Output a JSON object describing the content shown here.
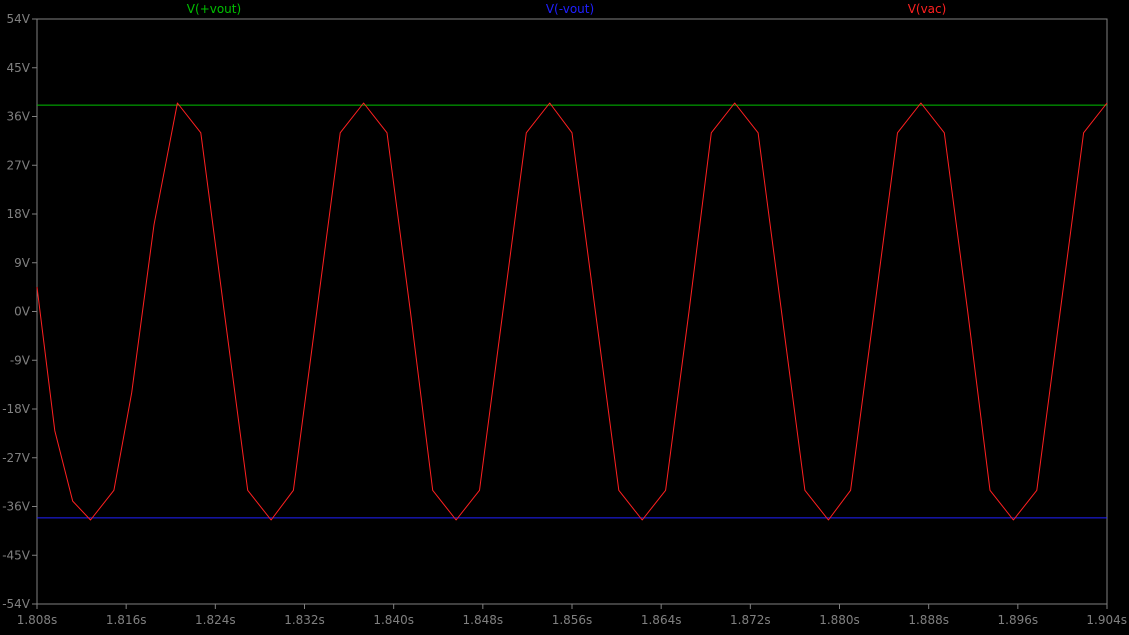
{
  "chart_data": {
    "type": "line",
    "title": "",
    "xlabel": "",
    "ylabel": "",
    "xlim": [
      1.808,
      1.904
    ],
    "ylim": [
      -54,
      54
    ],
    "x_ticks": [
      "1.808s",
      "1.816s",
      "1.824s",
      "1.832s",
      "1.840s",
      "1.848s",
      "1.856s",
      "1.864s",
      "1.872s",
      "1.880s",
      "1.888s",
      "1.896s",
      "1.904s"
    ],
    "y_ticks": [
      "54V",
      "45V",
      "36V",
      "27V",
      "18V",
      "9V",
      "0V",
      "-9V",
      "-18V",
      "-27V",
      "-36V",
      "-45V",
      "-54V"
    ],
    "legend_placement": "top",
    "grid": false,
    "background_color": "#000000",
    "axis_color": "#808080",
    "series": [
      {
        "name": "V(+vout)",
        "color": "#00c000",
        "x": [
          1.808,
          1.904
        ],
        "y": [
          38.1,
          38.1
        ]
      },
      {
        "name": "V(-vout)",
        "color": "#2020ff",
        "x": [
          1.808,
          1.904
        ],
        "y": [
          -38.1,
          -38.1
        ]
      },
      {
        "name": "V(vac)",
        "color": "#ff2020",
        "x": [
          1.808,
          1.8096,
          1.8112,
          1.8128,
          1.8149,
          1.8165,
          1.8185,
          1.8206,
          1.8227,
          1.8248,
          1.8269,
          1.829,
          1.831,
          1.8331,
          1.8352,
          1.8373,
          1.8394,
          1.8415,
          1.8435,
          1.8456,
          1.8477,
          1.8498,
          1.8519,
          1.854,
          1.856,
          1.8581,
          1.8602,
          1.8623,
          1.8644,
          1.8665,
          1.8685,
          1.8706,
          1.8727,
          1.8748,
          1.8769,
          1.879,
          1.881,
          1.8831,
          1.8852,
          1.8873,
          1.8894,
          1.8915,
          1.8935,
          1.8956,
          1.8977,
          1.8998,
          1.9019,
          1.904
        ],
        "y": [
          4.5,
          -22,
          -35,
          -38.5,
          -33,
          -15,
          16,
          38.5,
          33,
          0,
          -33,
          -38.5,
          -33,
          0,
          33,
          38.5,
          33,
          0,
          -33,
          -38.5,
          -33,
          0,
          33,
          38.5,
          33,
          0,
          -33,
          -38.5,
          -33,
          0,
          33,
          38.5,
          33,
          0,
          -33,
          -38.5,
          -33,
          0,
          33,
          38.5,
          33,
          0,
          -33,
          -38.5,
          -33,
          0,
          33,
          38.5
        ]
      }
    ]
  }
}
